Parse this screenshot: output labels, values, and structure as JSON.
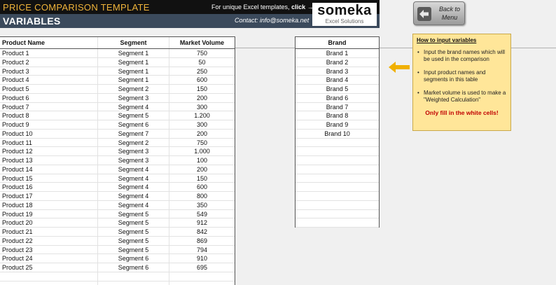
{
  "header": {
    "app_title": "PRICE COMPARISON TEMPLATE",
    "page_title": "VARIABLES",
    "promo_text": "For unique Excel templates,",
    "promo_link": "click",
    "contact": "Contact: info@someka.net",
    "logo_main": "someka",
    "logo_sub": "Excel Solutions"
  },
  "back_button": {
    "label_line1": "Back to",
    "label_line2": "Menu"
  },
  "product_table": {
    "columns": [
      "Product Name",
      "Segment",
      "Market Volume"
    ],
    "rows": [
      [
        "Product 1",
        "Segment 1",
        "750"
      ],
      [
        "Product 2",
        "Segment 1",
        "50"
      ],
      [
        "Product 3",
        "Segment 1",
        "250"
      ],
      [
        "Product 4",
        "Segment 1",
        "600"
      ],
      [
        "Product 5",
        "Segment 2",
        "150"
      ],
      [
        "Product 6",
        "Segment 3",
        "200"
      ],
      [
        "Product 7",
        "Segment 4",
        "300"
      ],
      [
        "Product 8",
        "Segment 5",
        "1.200"
      ],
      [
        "Product 9",
        "Segment 6",
        "300"
      ],
      [
        "Product 10",
        "Segment 7",
        "200"
      ],
      [
        "Product 11",
        "Segment 2",
        "750"
      ],
      [
        "Product 12",
        "Segment 3",
        "1.000"
      ],
      [
        "Product 13",
        "Segment 3",
        "100"
      ],
      [
        "Product 14",
        "Segment 4",
        "200"
      ],
      [
        "Product 15",
        "Segment 4",
        "150"
      ],
      [
        "Product 16",
        "Segment 4",
        "600"
      ],
      [
        "Product 17",
        "Segment 4",
        "800"
      ],
      [
        "Product 18",
        "Segment 4",
        "350"
      ],
      [
        "Product 19",
        "Segment 5",
        "549"
      ],
      [
        "Product 20",
        "Segment 5",
        "912"
      ],
      [
        "Product 21",
        "Segment 5",
        "842"
      ],
      [
        "Product 22",
        "Segment 5",
        "869"
      ],
      [
        "Product 23",
        "Segment 5",
        "794"
      ],
      [
        "Product 24",
        "Segment 6",
        "910"
      ],
      [
        "Product 25",
        "Segment 6",
        "695"
      ],
      [
        "",
        "",
        ""
      ],
      [
        "",
        "",
        ""
      ]
    ]
  },
  "brand_table": {
    "header": "Brand",
    "rows": [
      "Brand 1",
      "Brand 2",
      "Brand 3",
      "Brand 4",
      "Brand 5",
      "Brand 6",
      "Brand 7",
      "Brand 8",
      "Brand 9",
      "Brand 10",
      "",
      "",
      "",
      "",
      "",
      "",
      "",
      "",
      "",
      ""
    ]
  },
  "info_box": {
    "title": "How to input variables",
    "items": [
      "Input the brand names which will be used in the comparison",
      "Input product names and segments in this table",
      "Market volume is used to make a \"Weighted Calculation\""
    ],
    "note": "Only fill in the white cells!"
  },
  "colors": {
    "header_dark": "#111111",
    "header_slate": "#3b4a5c",
    "title_accent": "#f0b43a",
    "info_bg": "#ffe699",
    "note_red": "#c00000",
    "arrow": "#f0b000"
  }
}
